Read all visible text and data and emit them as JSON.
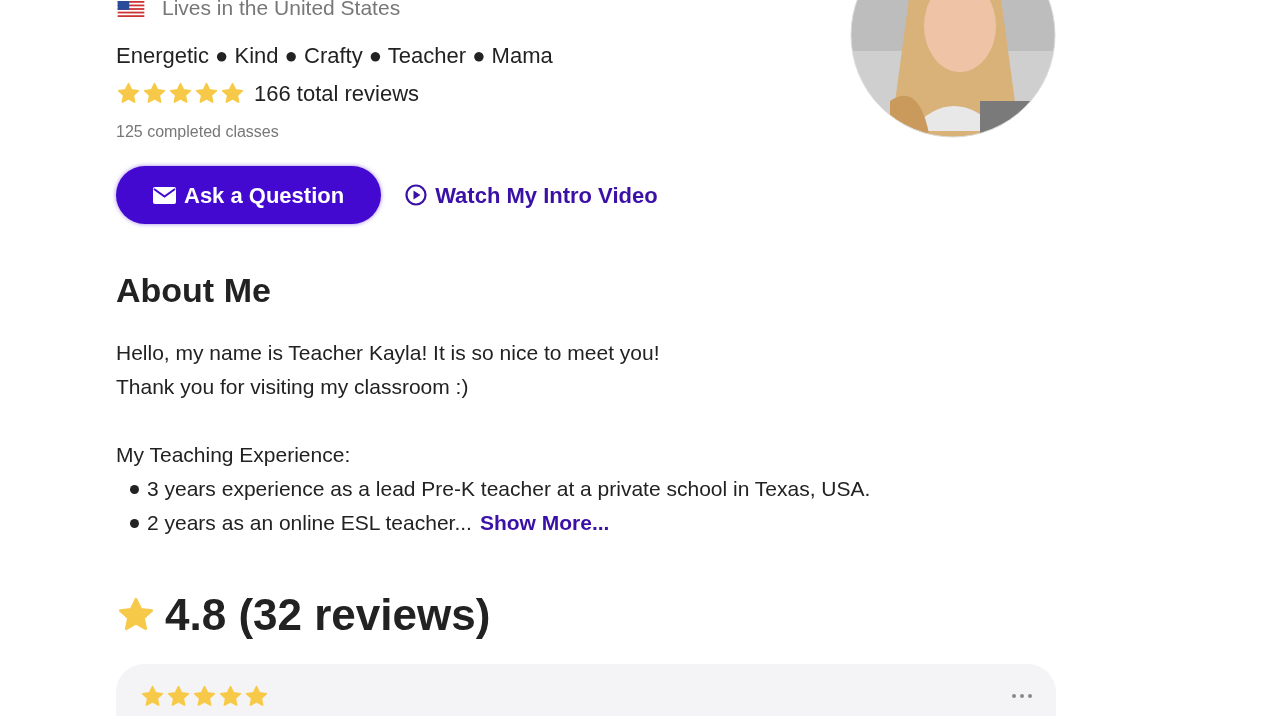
{
  "profile": {
    "location": "Lives in the United States",
    "traits": "Energetic ● Kind ● Crafty ● Teacher ● Mama",
    "stars": 5,
    "total_reviews": "166 total reviews",
    "completed": "125 completed classes"
  },
  "actions": {
    "ask_button": "Ask a Question",
    "video_link": "Watch My Intro Video"
  },
  "about": {
    "title": "About Me",
    "lines": [
      "Hello, my name is Teacher Kayla! It is so nice to meet you!",
      "Thank you for visiting my classroom :)"
    ],
    "subtitle": "My Teaching Experience:",
    "bullets": [
      "3 years experience as a lead Pre-K teacher at a private school in Texas, USA.",
      "2 years as an online ESL teacher..."
    ],
    "more_link": "Show More..."
  },
  "reviews": {
    "title": "4.8 (32 reviews)",
    "first_review": {
      "stars": 5
    }
  }
}
